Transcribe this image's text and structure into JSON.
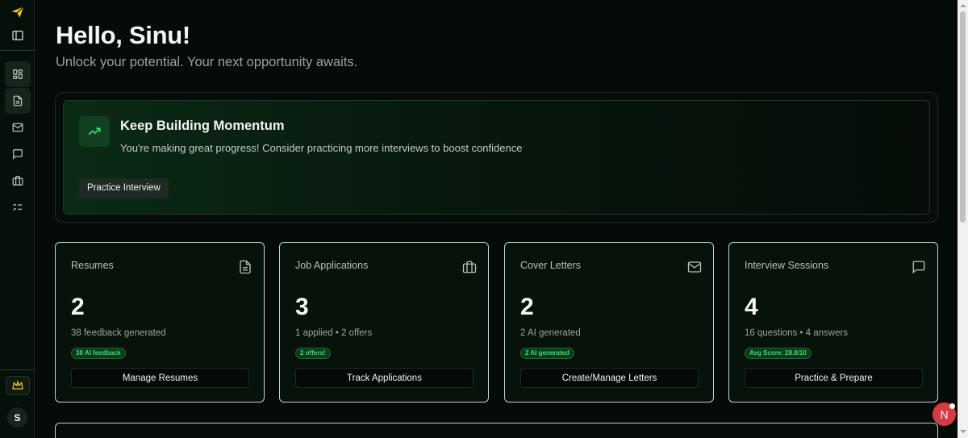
{
  "greeting": "Hello, Sinu!",
  "subtitle": "Unlock your potential. Your next opportunity awaits.",
  "banner": {
    "title": "Keep Building Momentum",
    "text": "You're making great progress! Consider practicing more interviews to boost confidence",
    "button": "Practice Interview",
    "icon": "trending-up-icon"
  },
  "sidebar": {
    "items": [
      {
        "name": "dashboard",
        "icon": "grid-icon"
      },
      {
        "name": "resumes",
        "icon": "document-icon"
      },
      {
        "name": "cover-letters",
        "icon": "mail-icon"
      },
      {
        "name": "interviews",
        "icon": "chat-icon"
      },
      {
        "name": "applications",
        "icon": "briefcase-icon"
      },
      {
        "name": "tasks",
        "icon": "checklist-icon"
      }
    ],
    "avatar_initial": "S"
  },
  "cards": [
    {
      "title": "Resumes",
      "value": "2",
      "sub": "38 feedback generated",
      "badge": "38 AI feedback",
      "button": "Manage Resumes",
      "icon": "document-icon"
    },
    {
      "title": "Job Applications",
      "value": "3",
      "sub": "1 applied • 2 offers",
      "badge": "2 offers!",
      "button": "Track Applications",
      "icon": "briefcase-icon"
    },
    {
      "title": "Cover Letters",
      "value": "2",
      "sub": "2 AI generated",
      "badge": "2 AI generated",
      "button": "Create/Manage Letters",
      "icon": "mail-icon"
    },
    {
      "title": "Interview Sessions",
      "value": "4",
      "sub": "16 questions • 4 answers",
      "badge": "Avg Score: 28.8/10",
      "button": "Practice & Prepare",
      "icon": "chat-icon"
    }
  ],
  "fab_label": "N",
  "colors": {
    "accent": "#34e06b",
    "background": "#050b07",
    "logo": "#f5c518",
    "fab": "#d63a43"
  }
}
